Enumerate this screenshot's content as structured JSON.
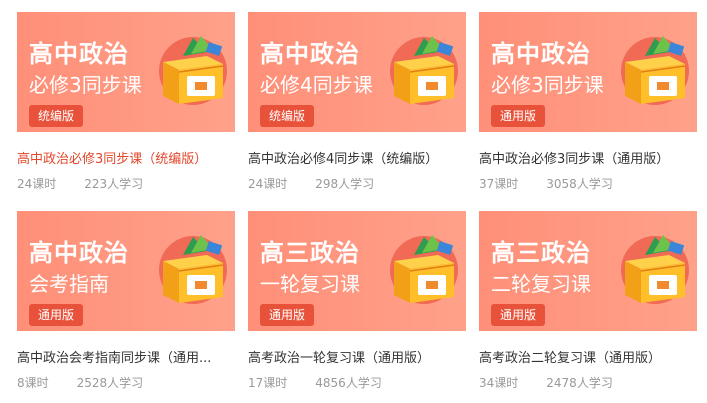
{
  "courses": [
    {
      "thumb_title": "高中政治",
      "thumb_subtitle": "必修3同步课",
      "badge": "统编版",
      "title": "高中政治必修3同步课（统编版）",
      "lessons": "24课时",
      "students": "223人学习",
      "active": true
    },
    {
      "thumb_title": "高中政治",
      "thumb_subtitle": "必修4同步课",
      "badge": "统编版",
      "title": "高中政治必修4同步课（统编版）",
      "lessons": "24课时",
      "students": "298人学习",
      "active": false
    },
    {
      "thumb_title": "高中政治",
      "thumb_subtitle": "必修3同步课",
      "badge": "通用版",
      "title": "高中政治必修3同步课（通用版）",
      "lessons": "37课时",
      "students": "3058人学习",
      "active": false
    },
    {
      "thumb_title": "高中政治",
      "thumb_subtitle": "会考指南",
      "badge": "通用版",
      "title": "高中政治会考指南同步课（通用...",
      "lessons": "8课时",
      "students": "2528人学习",
      "active": false
    },
    {
      "thumb_title": "高三政治",
      "thumb_subtitle": "一轮复习课",
      "badge": "通用版",
      "title": "高考政治一轮复习课（通用版）",
      "lessons": "17课时",
      "students": "4856人学习",
      "active": false
    },
    {
      "thumb_title": "高三政治",
      "thumb_subtitle": "二轮复习课",
      "badge": "通用版",
      "title": "高考政治二轮复习课（通用版）",
      "lessons": "34课时",
      "students": "2478人学习",
      "active": false
    }
  ],
  "icons": {
    "thumbnail": "treasure-box-icon"
  },
  "colors": {
    "thumb_bg": "#ff9a83",
    "badge_bg": "#e8523a",
    "active_title": "#e2472c"
  }
}
